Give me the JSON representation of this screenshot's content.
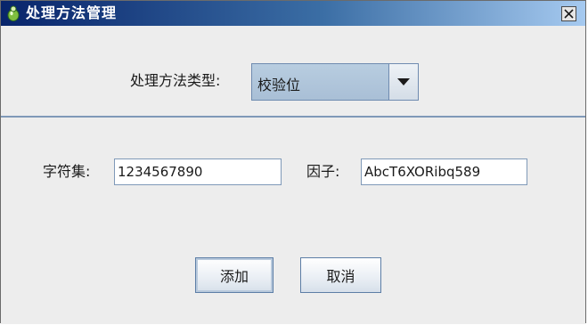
{
  "window": {
    "title": "处理方法管理"
  },
  "method_type": {
    "label": "处理方法类型:",
    "selected": "校验位"
  },
  "charset": {
    "label": "字符集:",
    "value": "1234567890"
  },
  "factor": {
    "label": "因子:",
    "value": "AbcT6XORibq589"
  },
  "buttons": {
    "add": "添加",
    "cancel": "取消"
  },
  "colors": {
    "titlebar_start": "#08246b",
    "combo_bg": "#a9bfd6"
  },
  "icons": {
    "app": "app-icon",
    "close": "close-icon",
    "dropdown": "chevron-down-icon"
  }
}
